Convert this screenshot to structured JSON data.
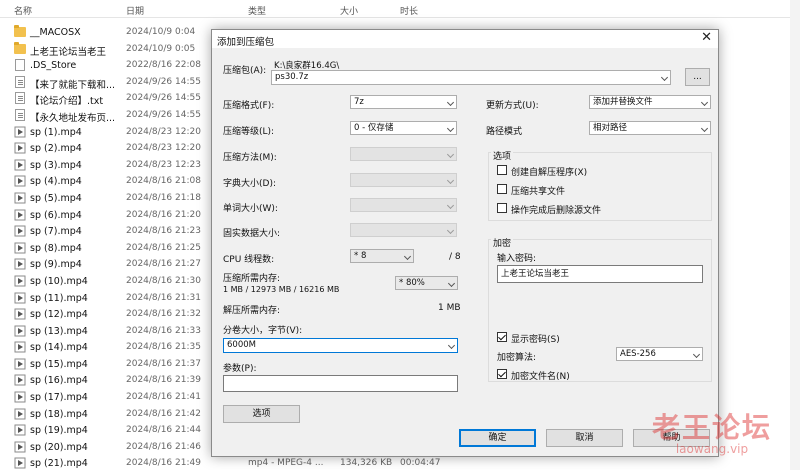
{
  "explorer": {
    "columns": {
      "name": "名称",
      "date": "日期",
      "type": "类型",
      "size": "大小",
      "length": "时长"
    },
    "files": [
      {
        "name": "__MACOSX",
        "date": "2024/10/9 0:04",
        "icon": "folder-icon"
      },
      {
        "name": "上老王论坛当老王",
        "date": "2024/10/9 0:05",
        "icon": "folder-icon"
      },
      {
        "name": ".DS_Store",
        "date": "2022/8/16 22:08",
        "icon": "file-icon"
      },
      {
        "name": "【来了就能下载和...",
        "date": "2024/9/26 14:55",
        "icon": "text-file-icon"
      },
      {
        "name": "【论坛介绍】.txt",
        "date": "2024/9/26 14:55",
        "icon": "text-file-icon"
      },
      {
        "name": "【永久地址发布页...",
        "date": "2024/9/26 14:55",
        "icon": "text-file-icon"
      },
      {
        "name": "sp (1).mp4",
        "date": "2024/8/23 12:20",
        "icon": "video-file-icon"
      },
      {
        "name": "sp (2).mp4",
        "date": "2024/8/23 12:20",
        "icon": "video-file-icon"
      },
      {
        "name": "sp (3).mp4",
        "date": "2024/8/23 12:23",
        "icon": "video-file-icon"
      },
      {
        "name": "sp (4).mp4",
        "date": "2024/8/16 21:08",
        "icon": "video-file-icon"
      },
      {
        "name": "sp (5).mp4",
        "date": "2024/8/16 21:18",
        "icon": "video-file-icon"
      },
      {
        "name": "sp (6).mp4",
        "date": "2024/8/16 21:20",
        "icon": "video-file-icon"
      },
      {
        "name": "sp (7).mp4",
        "date": "2024/8/16 21:23",
        "icon": "video-file-icon"
      },
      {
        "name": "sp (8).mp4",
        "date": "2024/8/16 21:25",
        "icon": "video-file-icon"
      },
      {
        "name": "sp (9).mp4",
        "date": "2024/8/16 21:27",
        "icon": "video-file-icon"
      },
      {
        "name": "sp (10).mp4",
        "date": "2024/8/16 21:30",
        "icon": "video-file-icon"
      },
      {
        "name": "sp (11).mp4",
        "date": "2024/8/16 21:31",
        "icon": "video-file-icon"
      },
      {
        "name": "sp (12).mp4",
        "date": "2024/8/16 21:32",
        "icon": "video-file-icon"
      },
      {
        "name": "sp (13).mp4",
        "date": "2024/8/16 21:33",
        "icon": "video-file-icon"
      },
      {
        "name": "sp (14).mp4",
        "date": "2024/8/16 21:35",
        "icon": "video-file-icon"
      },
      {
        "name": "sp (15).mp4",
        "date": "2024/8/16 21:37",
        "icon": "video-file-icon"
      },
      {
        "name": "sp (16).mp4",
        "date": "2024/8/16 21:39",
        "icon": "video-file-icon"
      },
      {
        "name": "sp (17).mp4",
        "date": "2024/8/16 21:41",
        "icon": "video-file-icon"
      },
      {
        "name": "sp (18).mp4",
        "date": "2024/8/16 21:42",
        "icon": "video-file-icon"
      },
      {
        "name": "sp (19).mp4",
        "date": "2024/8/16 21:44",
        "icon": "video-file-icon"
      },
      {
        "name": "sp (20).mp4",
        "date": "2024/8/16 21:46",
        "icon": "video-file-icon"
      },
      {
        "name": "sp (21).mp4",
        "date": "2024/8/16 21:49",
        "icon": "video-file-icon",
        "type": "mp4 - MPEG-4 ...",
        "size": "134,326 KB",
        "length": "00:04:47"
      }
    ]
  },
  "dialog": {
    "title": "添加到压缩包",
    "archive_label": "压缩包(A):",
    "archive_path": "K:\\良家群16.4G\\",
    "archive_name": "ps30.7z",
    "browse_label": "...",
    "format_label": "压缩格式(F):",
    "format_value": "7z",
    "level_label": "压缩等级(L):",
    "level_value": "0 - 仅存储",
    "method_label": "压缩方法(M):",
    "dict_label": "字典大小(D):",
    "word_label": "单词大小(W):",
    "solid_label": "固实数据大小:",
    "threads_label": "CPU 线程数:",
    "threads_value": "* 8",
    "threads_max": "/ 8",
    "mem_label": "压缩所需内存:",
    "mem_detail": "1 MB / 12973 MB / 16216 MB",
    "mem_percent": "* 80%",
    "decomp_label": "解压所需内存:",
    "decomp_value": "1 MB",
    "volume_label": "分卷大小，字节(V):",
    "volume_value": "6000M",
    "params_label": "参数(P):",
    "params_value": "",
    "options_button": "选项",
    "update_label": "更新方式(U):",
    "update_value": "添加并替换文件",
    "path_label": "路径模式",
    "path_value": "相对路径",
    "options_group": "选项",
    "opt_sfx": "创建自解压程序(X)",
    "opt_shared": "压缩共享文件",
    "opt_delete": "操作完成后删除源文件",
    "encrypt_group": "加密",
    "password_label": "输入密码:",
    "password_value": "上老王论坛当老王",
    "show_password": "显示密码(S)",
    "enc_method_label": "加密算法:",
    "enc_method_value": "AES-256",
    "encrypt_names": "加密文件名(N)",
    "ok_button": "确定",
    "cancel_button": "取消",
    "help_button": "帮助",
    "checked": {
      "sfx": false,
      "shared": false,
      "delete": false,
      "show_password": true,
      "encrypt_names": true
    }
  },
  "watermark": {
    "title": "老王论坛",
    "url": "laowang.vip"
  },
  "colors": {
    "accent": "#0078d7",
    "watermark": "#dc2828",
    "folder": "#f2c14e"
  }
}
